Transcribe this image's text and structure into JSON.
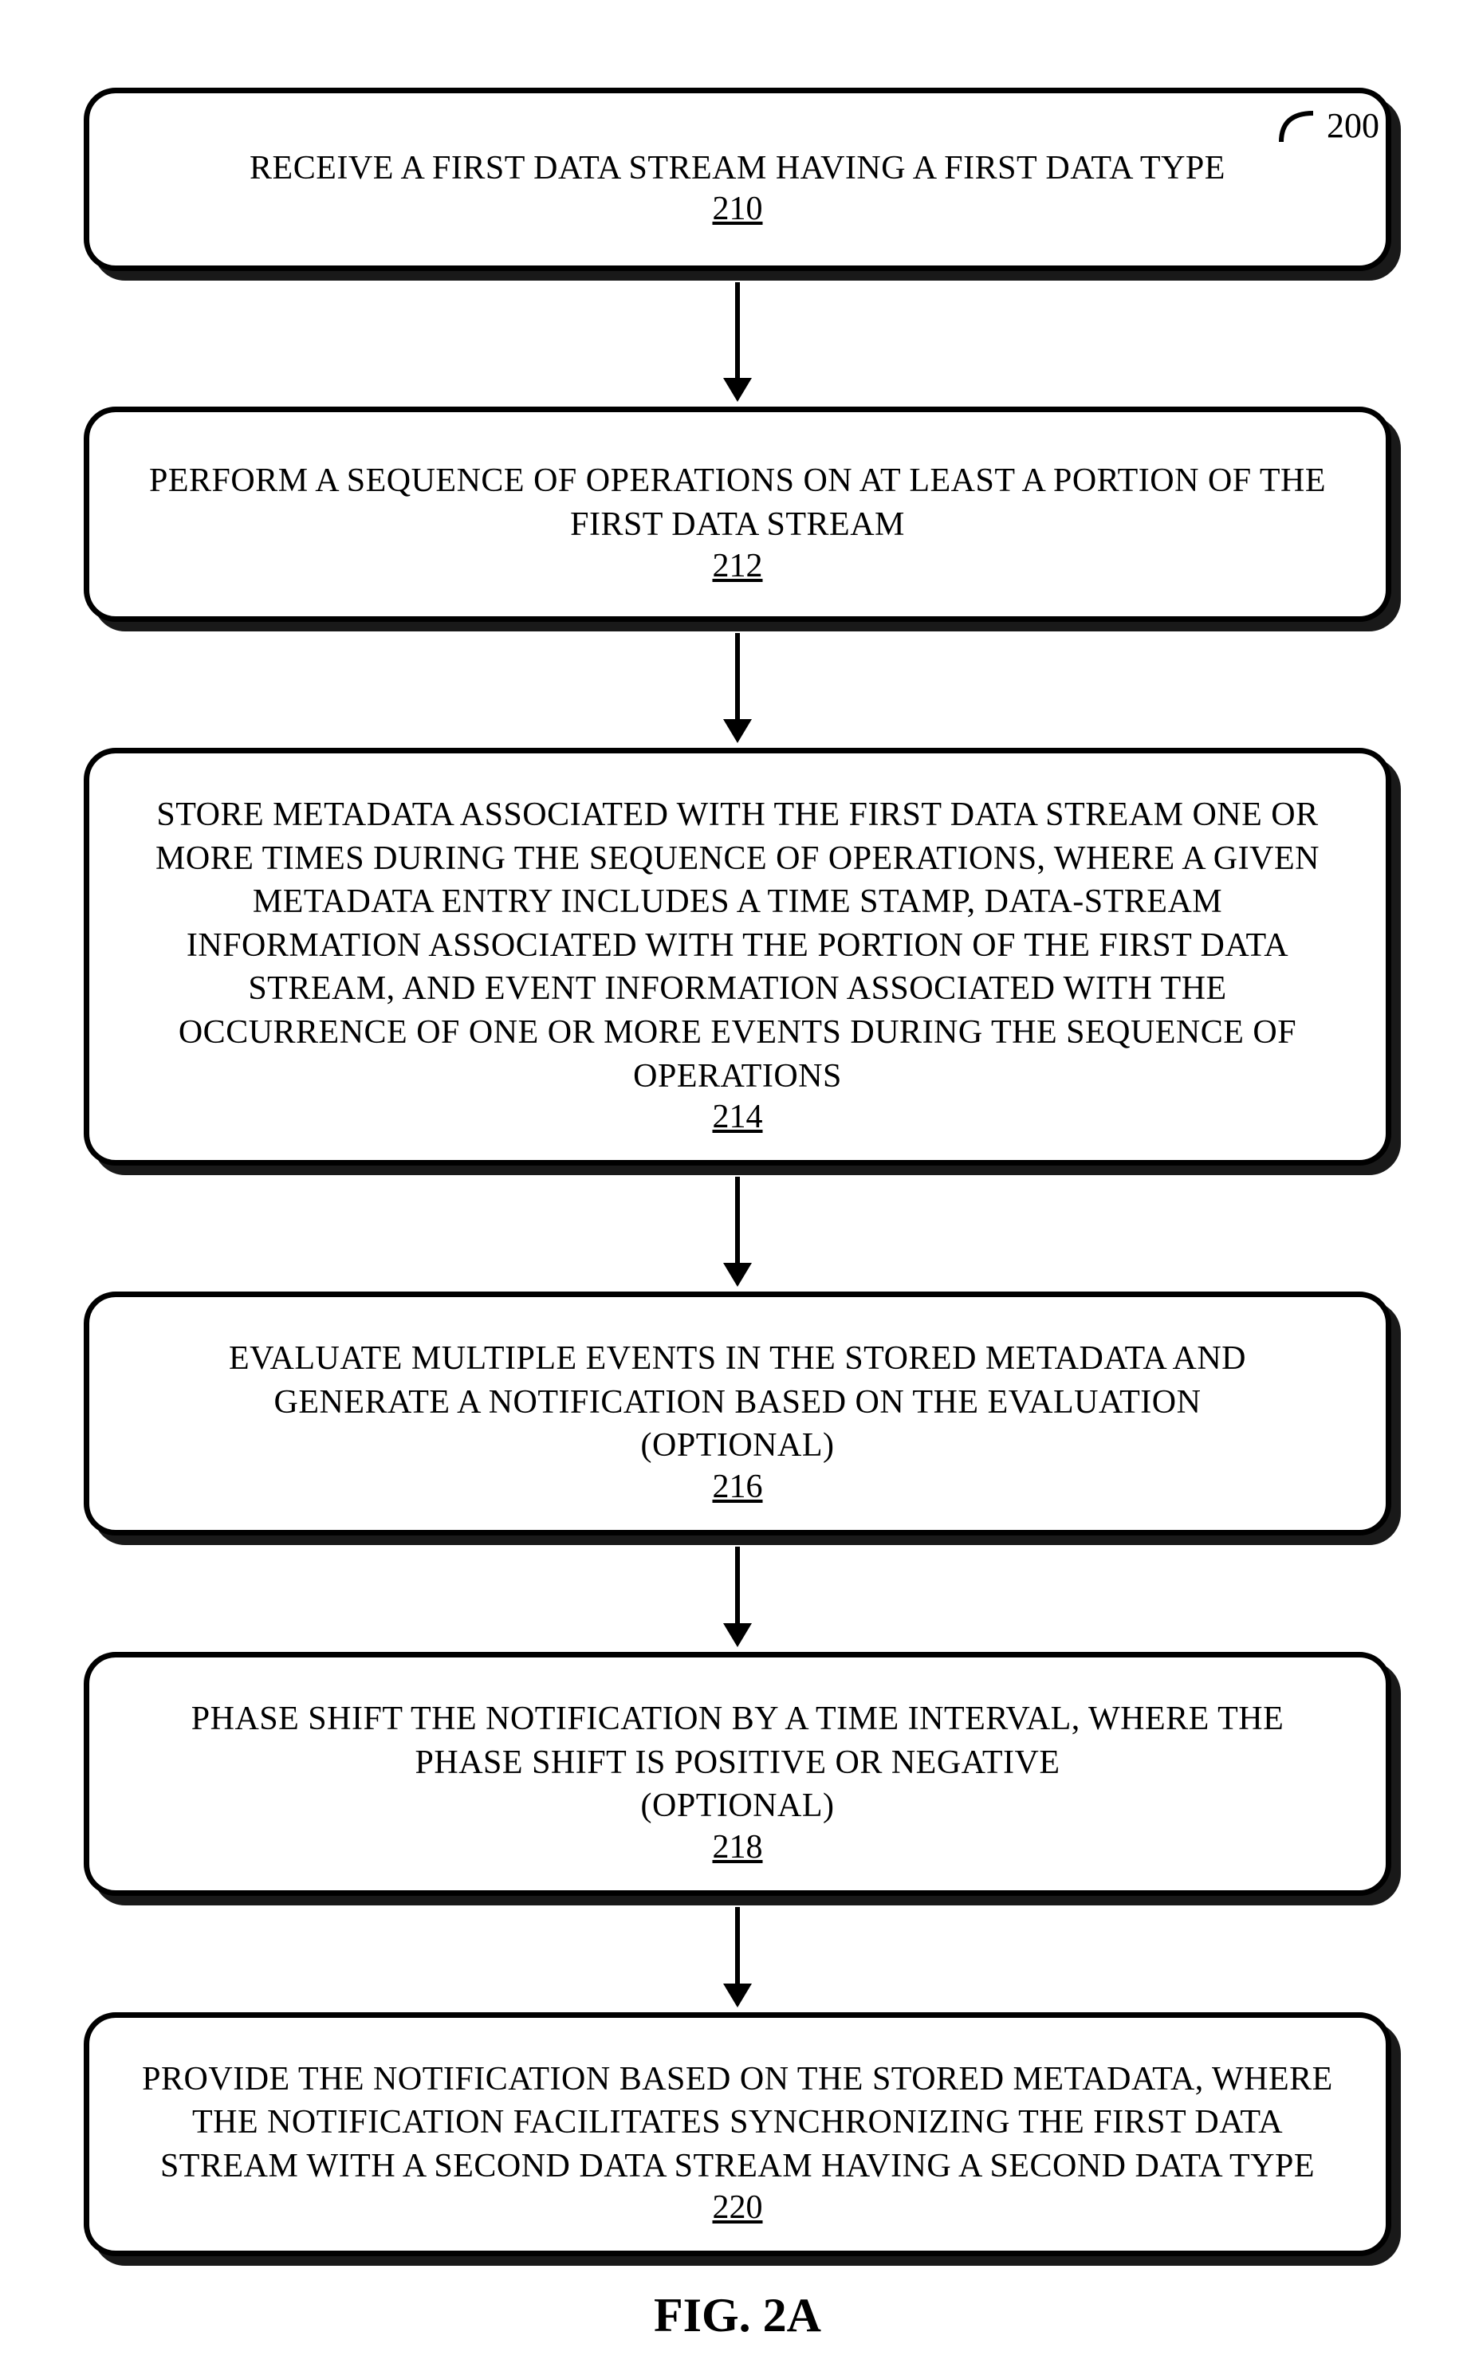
{
  "figure": {
    "number_label": "200",
    "caption": "FIG. 2A"
  },
  "steps": [
    {
      "text": "RECEIVE A FIRST DATA STREAM HAVING A FIRST DATA TYPE",
      "ref": "210",
      "optional": false
    },
    {
      "text": "PERFORM A SEQUENCE OF OPERATIONS ON AT LEAST A PORTION OF THE FIRST DATA STREAM",
      "ref": "212",
      "optional": false
    },
    {
      "text": "STORE METADATA ASSOCIATED WITH THE FIRST DATA STREAM ONE OR MORE TIMES DURING THE SEQUENCE OF OPERATIONS, WHERE A GIVEN METADATA ENTRY INCLUDES A TIME STAMP, DATA-STREAM INFORMATION ASSOCIATED WITH THE PORTION OF THE FIRST DATA STREAM, AND EVENT INFORMATION ASSOCIATED WITH THE OCCURRENCE OF ONE OR MORE EVENTS DURING THE SEQUENCE OF OPERATIONS",
      "ref": "214",
      "optional": false
    },
    {
      "text": "EVALUATE MULTIPLE EVENTS IN THE STORED METADATA AND GENERATE A NOTIFICATION BASED ON THE EVALUATION",
      "ref": "216",
      "optional": true,
      "optional_text": "(OPTIONAL)"
    },
    {
      "text": "PHASE SHIFT THE NOTIFICATION BY A TIME INTERVAL, WHERE THE PHASE SHIFT IS POSITIVE OR NEGATIVE",
      "ref": "218",
      "optional": true,
      "optional_text": "(OPTIONAL)"
    },
    {
      "text": "PROVIDE THE NOTIFICATION BASED ON THE STORED METADATA, WHERE THE NOTIFICATION FACILITATES SYNCHRONIZING THE FIRST DATA STREAM WITH A SECOND DATA STREAM HAVING A SECOND DATA TYPE",
      "ref": "220",
      "optional": false
    }
  ]
}
